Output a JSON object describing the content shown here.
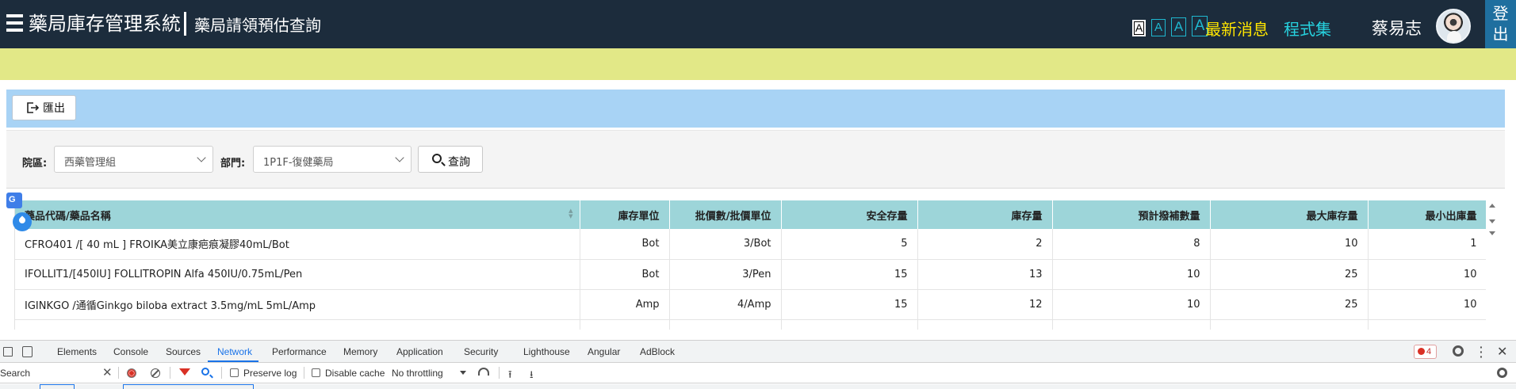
{
  "header": {
    "app_title": "藥局庫存管理系統",
    "page_title": "藥局請領預估查詢",
    "font_sizes": [
      "A",
      "A",
      "A",
      "A"
    ],
    "news_link": "最新消息",
    "programs_link": "程式集",
    "user_name": "蔡易志",
    "logout": "登出",
    "colors": {
      "bar": "#1c2c3c",
      "news": "#ffe600",
      "programs": "#27d3e0",
      "logout_bg": "#1f6f9f"
    }
  },
  "notice_strip": {
    "color": "#e2e887"
  },
  "toolbar": {
    "export_label": "匯出",
    "icon": "export-icon",
    "color": "#a8d3f5"
  },
  "filters": {
    "campus_label": "院區:",
    "campus_value": "西藥管理組",
    "department_label": "部門:",
    "department_value": "1P1F-復健藥局",
    "query_label": "查詢"
  },
  "table": {
    "columns": [
      "藥品代碼/藥品名稱",
      "庫存單位",
      "批價數/批價單位",
      "安全存量",
      "庫存量",
      "預計撥補數量",
      "最大庫存量",
      "最小出庫量"
    ],
    "rows": [
      [
        "CFRO401 /[ 40 mL ] FROIKA美立康疤痕凝膠40mL/Bot",
        "Bot",
        "3/Bot",
        "5",
        "2",
        "8",
        "10",
        "1"
      ],
      [
        "IFOLLIT1/[450IU] FOLLITROPIN Alfa 450IU/0.75mL/Pen",
        "Bot",
        "3/Pen",
        "15",
        "13",
        "10",
        "25",
        "10"
      ],
      [
        "IGINKGO /通循Ginkgo biloba extract 3.5mg/mL 5mL/Amp",
        "Amp",
        "4/Amp",
        "15",
        "12",
        "10",
        "25",
        "10"
      ]
    ],
    "header_color": "#9dd5d9"
  },
  "devtools": {
    "tabs": [
      "Elements",
      "Console",
      "Sources",
      "Network",
      "Performance",
      "Memory",
      "Application",
      "Security",
      "Lighthouse",
      "Angular",
      "AdBlock"
    ],
    "active_tab": "Network",
    "error_count": "4",
    "search_placeholder": "Search",
    "preserve_log": "Preserve log",
    "disable_cache": "Disable cache",
    "throttling": "No throttling"
  }
}
